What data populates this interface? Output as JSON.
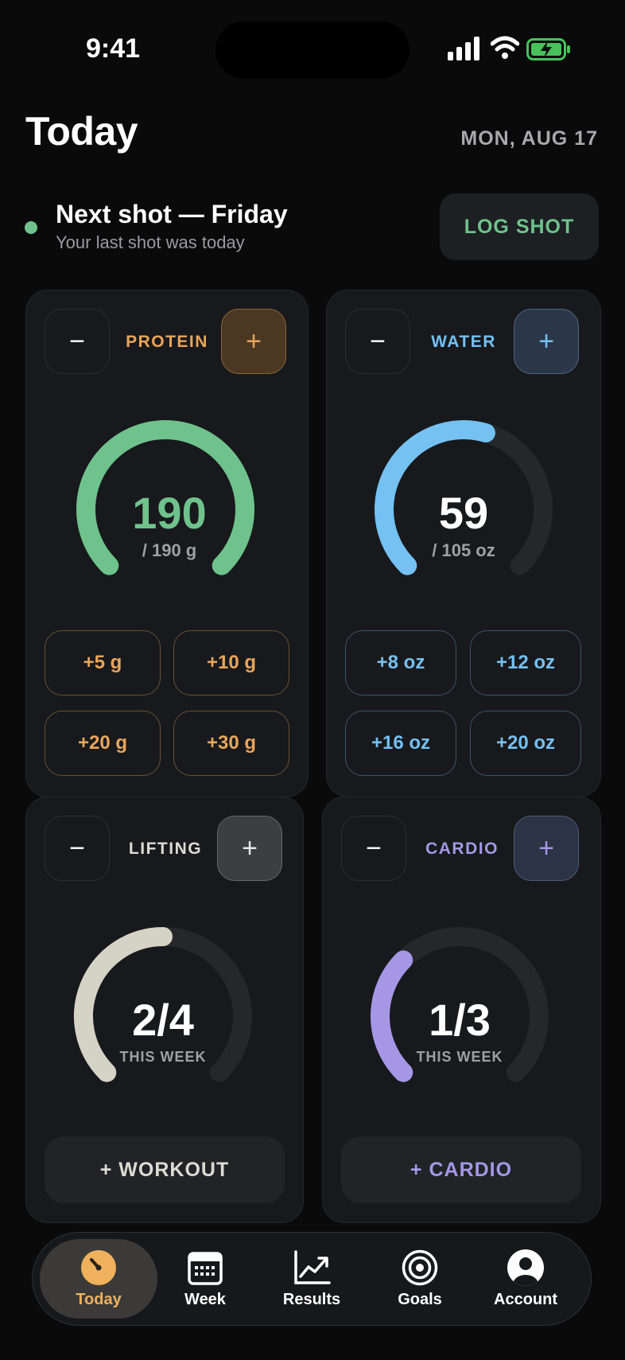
{
  "status": {
    "time": "9:41"
  },
  "header": {
    "title": "Today",
    "date": "MON, AUG 17"
  },
  "shot": {
    "title": "Next shot — Friday",
    "subtitle": "Your last shot was today",
    "button": "LOG SHOT"
  },
  "cards": {
    "protein": {
      "label": "PROTEIN",
      "value": "190",
      "target": "/ 190 g",
      "progress": 1.0,
      "color": "#e8a55b",
      "ring": "#6fc28c",
      "quick": [
        "+5 g",
        "+10 g",
        "+20 g",
        "+30 g"
      ]
    },
    "water": {
      "label": "WATER",
      "value": "59",
      "target": "/ 105 oz",
      "progress": 0.56,
      "color": "#74c1f2",
      "ring": "#74c1f2",
      "quick": [
        "+8 oz",
        "+12 oz",
        "+16 oz",
        "+20 oz"
      ]
    },
    "lifting": {
      "label": "LIFTING",
      "value": "2/4",
      "target": "THIS WEEK",
      "progress": 0.5,
      "color": "#dddbd2",
      "ring": "#d5d2c6",
      "action": "+ WORKOUT"
    },
    "cardio": {
      "label": "CARDIO",
      "value": "1/3",
      "target": "THIS WEEK",
      "progress": 0.333,
      "color": "#a597e6",
      "ring": "#a597e6",
      "action": "+ CARDIO"
    }
  },
  "controls": {
    "minus": "−",
    "plus": "+"
  },
  "tabs": [
    {
      "label": "Today",
      "icon": "gauge-icon"
    },
    {
      "label": "Week",
      "icon": "calendar-icon"
    },
    {
      "label": "Results",
      "icon": "chart-icon"
    },
    {
      "label": "Goals",
      "icon": "target-icon"
    },
    {
      "label": "Account",
      "icon": "person-icon"
    }
  ]
}
